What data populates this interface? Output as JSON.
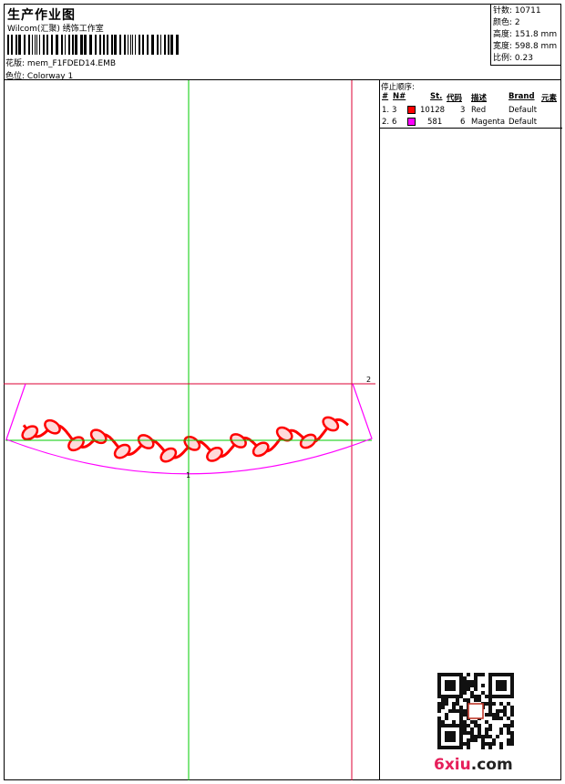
{
  "header": {
    "title": "生产作业图",
    "studio": "Wilcom(汇聚) 绣饰工作室",
    "design_label": "花版:",
    "design_value": "mem_F1FDED14.EMB",
    "colorway_label": "色位:",
    "colorway_value": "Colorway 1"
  },
  "stats": [
    {
      "label": "针数:",
      "value": "10711"
    },
    {
      "label": "颜色:",
      "value": "2"
    },
    {
      "label": "高度:",
      "value": "151.8 mm"
    },
    {
      "label": "宽度:",
      "value": "598.8 mm"
    },
    {
      "label": "比例:",
      "value": "0.23"
    }
  ],
  "stop_sequence": {
    "title": "停止顺序:",
    "headers": [
      "#",
      "N#",
      "St.",
      "代码",
      "描述",
      "Brand",
      "元素"
    ],
    "rows": [
      {
        "index": "1.",
        "needle": "3",
        "stitches": "10128",
        "code": "3",
        "description": "Red",
        "brand": "Default",
        "color": "#ff0000"
      },
      {
        "index": "2.",
        "needle": "6",
        "stitches": "581",
        "code": "6",
        "description": "Magenta",
        "brand": "Default",
        "color": "#ff00ff"
      }
    ]
  },
  "canvas": {
    "marker_1": "1",
    "marker_2": "2",
    "colors": {
      "guide_green": "#00cc00",
      "guide_red": "#dd0033",
      "outline_magenta": "#ff00ff",
      "motif_red": "#ff0000"
    }
  },
  "watermark": {
    "site_prefix": "6xiu",
    "site_suffix": ".com"
  }
}
